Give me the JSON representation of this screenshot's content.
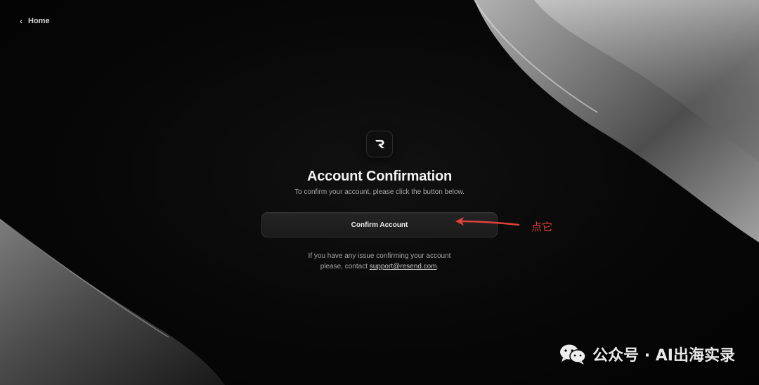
{
  "nav": {
    "back_label": "Home"
  },
  "logo": {
    "icon": "resend-r-logo-icon"
  },
  "main": {
    "title": "Account Confirmation",
    "subtitle": "To confirm your account, please click the button below.",
    "confirm_button_label": "Confirm Account",
    "help_line1": "If you have any issue confirming your account",
    "help_prefix": "please, contact ",
    "support_email": "support@resend.com",
    "help_suffix": "."
  },
  "annotation": {
    "text": "点它",
    "color": "#e2423a"
  },
  "watermark": {
    "icon": "wechat-icon",
    "text": "公众号 · AI出海实录"
  },
  "colors": {
    "background": "#050505",
    "button_bg": "#1f1f1f",
    "annotation_red": "#e2423a"
  }
}
